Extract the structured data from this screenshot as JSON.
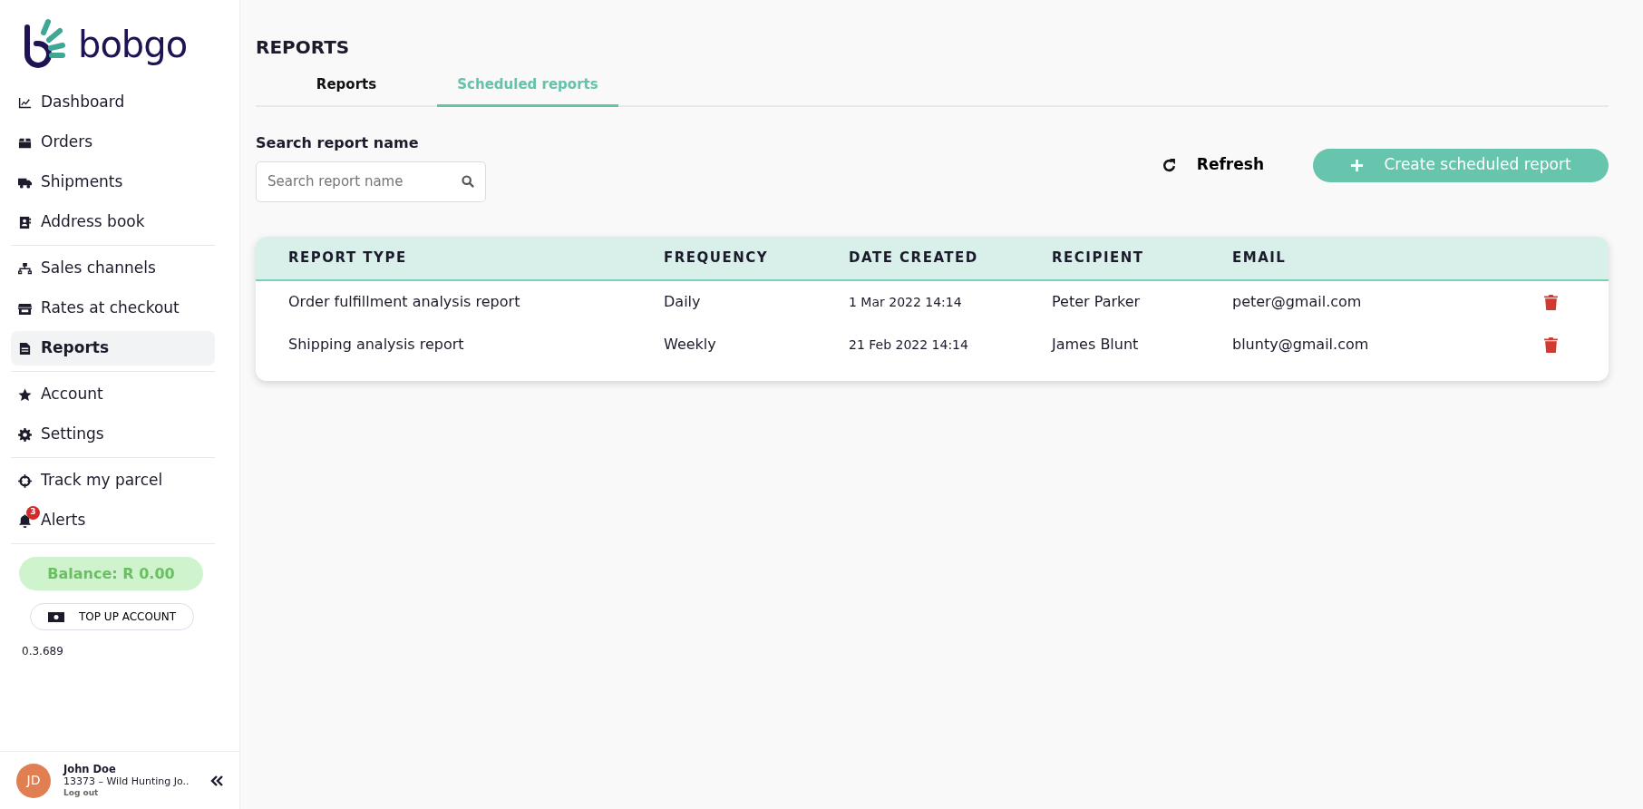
{
  "sidebar": {
    "logo": "bobgo",
    "groups": [
      {
        "items": [
          {
            "label": "Dashboard",
            "selected": false
          },
          {
            "label": "Orders",
            "selected": false
          },
          {
            "label": "Shipments",
            "selected": false
          },
          {
            "label": "Address book",
            "selected": false
          }
        ]
      },
      {
        "items": [
          {
            "label": "Sales channels",
            "selected": false
          },
          {
            "label": "Rates at checkout",
            "selected": false
          },
          {
            "label": "Reports",
            "selected": true
          }
        ]
      },
      {
        "items": [
          {
            "label": "Account",
            "selected": false
          },
          {
            "label": "Settings",
            "selected": false
          }
        ]
      },
      {
        "items": [
          {
            "label": "Track my parcel",
            "selected": false
          },
          {
            "label": "Alerts",
            "selected": false,
            "badge": "3"
          }
        ]
      }
    ],
    "balance": "Balance: R 0.00",
    "top_up": "TOP UP ACCOUNT",
    "version": "0.3.689",
    "user": {
      "initials": "JD",
      "name": "John Doe",
      "account": "13373 – Wild Hunting Jo..",
      "logout": "Log out"
    }
  },
  "page": {
    "title": "REPORTS",
    "tabs": [
      {
        "label": "Reports",
        "selected": false
      },
      {
        "label": "Scheduled reports",
        "selected": true
      }
    ],
    "search": {
      "label": "Search report name",
      "placeholder": "Search report name"
    },
    "refresh": "Refresh",
    "create": "Create scheduled report",
    "table": {
      "columns": [
        "REPORT TYPE",
        "FREQUENCY",
        "DATE CREATED",
        "RECIPIENT",
        "EMAIL"
      ],
      "rows": [
        [
          "Order fulfillment analysis report",
          "Daily",
          "1 Mar 2022 14:14",
          "Peter Parker",
          "peter@gmail.com"
        ],
        [
          "Shipping analysis report",
          "Weekly",
          "21 Feb 2022 14:14",
          "James Blunt",
          "blunty@gmail.com"
        ]
      ]
    }
  }
}
